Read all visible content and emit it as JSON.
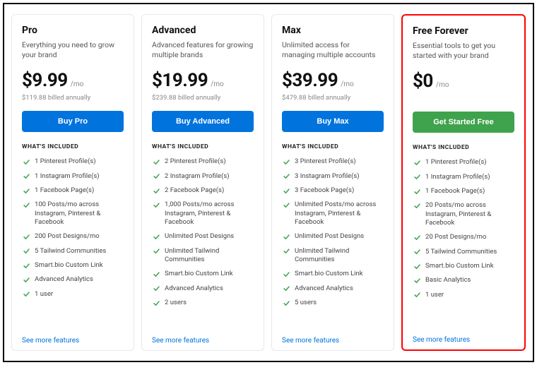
{
  "section_title": "WHAT'S INCLUDED",
  "see_more": "See more features",
  "plans": [
    {
      "name": "Pro",
      "desc": "Everything you need to grow your brand",
      "price": "$9.99",
      "period": "/mo",
      "billed": "$119.88 billed annually",
      "cta": "Buy Pro",
      "cta_style": "blue",
      "highlight": false,
      "features": [
        "1 Pinterest Profile(s)",
        "1 Instagram Profile(s)",
        "1 Facebook Page(s)",
        "100 Posts/mo across Instagram, Pinterest & Facebook",
        "200 Post Designs/mo",
        "5 Tailwind Communities",
        "Smart.bio Custom Link",
        "Advanced Analytics",
        "1 user"
      ]
    },
    {
      "name": "Advanced",
      "desc": "Advanced features for growing multiple brands",
      "price": "$19.99",
      "period": "/mo",
      "billed": "$239.88 billed annually",
      "cta": "Buy Advanced",
      "cta_style": "blue",
      "highlight": false,
      "features": [
        "2 Pinterest Profile(s)",
        "2 Instagram Profile(s)",
        "2 Facebook Page(s)",
        "1,000 Posts/mo across Instagram, Pinterest & Facebook",
        "Unlimited Post Designs",
        "Unlimited Tailwind Communities",
        "Smart.bio Custom Link",
        "Advanced Analytics",
        "2 users"
      ]
    },
    {
      "name": "Max",
      "desc": "Unlimited access for managing multiple accounts",
      "price": "$39.99",
      "period": "/mo",
      "billed": "$479.88 billed annually",
      "cta": "Buy Max",
      "cta_style": "blue",
      "highlight": false,
      "features": [
        "3 Pinterest Profile(s)",
        "3 Instagram Profile(s)",
        "3 Facebook Page(s)",
        "Unlimited Posts/mo across Instagram, Pinterest & Facebook",
        "Unlimited Post Designs",
        "Unlimited Tailwind Communities",
        "Smart.bio Custom Link",
        "Advanced Analytics",
        "5 users"
      ]
    },
    {
      "name": "Free Forever",
      "desc": "Essential tools to get you started with your brand",
      "price": "$0",
      "period": "/mo",
      "billed": "",
      "cta": "Get Started Free",
      "cta_style": "green",
      "highlight": true,
      "features": [
        "1 Pinterest Profile(s)",
        "1 Instagram Profile(s)",
        "1 Facebook Page(s)",
        "20 Posts/mo across Instagram, Pinterest & Facebook",
        "20 Post Designs/mo",
        "5 Tailwind Communities",
        "Smart.bio Custom Link",
        "Basic Analytics",
        "1 user"
      ]
    }
  ]
}
